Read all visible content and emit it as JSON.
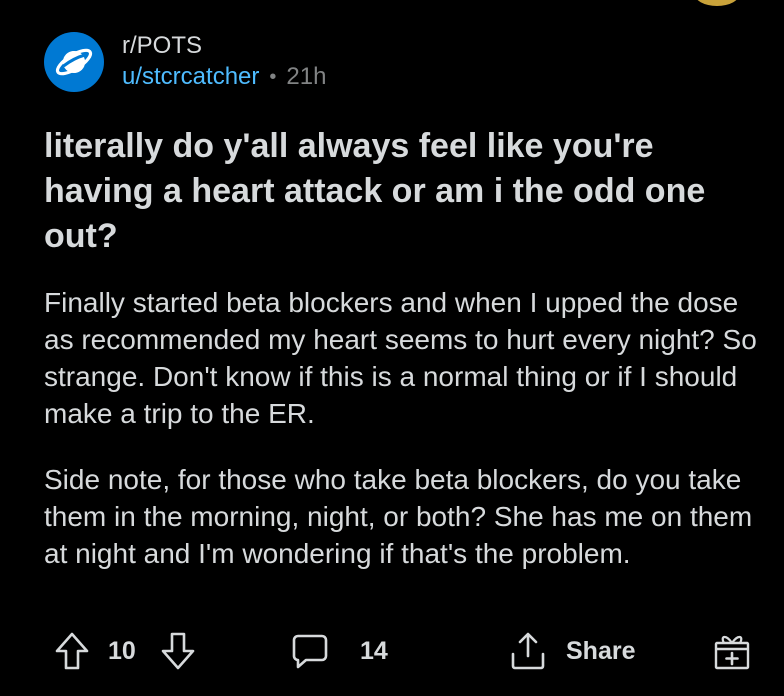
{
  "post": {
    "subreddit": "r/POTS",
    "username": "u/stcrcatcher",
    "separator": "•",
    "time_ago": "21h",
    "title": "literally do y'all always feel like you're having a heart attack or am i the odd one out?",
    "body": [
      "Finally started beta blockers and when I upped the dose as recommended my heart seems to hurt every night? So strange. Don't know if this is a normal thing or if I should make a trip to the ER.",
      "Side note, for those who take beta blockers, do you take them in the morning, night, or both? She has me on them at night and I'm wondering if that's the problem."
    ]
  },
  "actions": {
    "upvote_icon": "upvote-arrow-icon",
    "vote_count": "10",
    "downvote_icon": "downvote-arrow-icon",
    "comment_icon": "comment-bubble-icon",
    "comment_count": "14",
    "share_icon": "share-icon",
    "share_label": "Share",
    "award_icon": "gift-award-icon"
  },
  "colors": {
    "background": "#000000",
    "text": "#d7dadc",
    "username": "#4fbcff",
    "meta": "#818384",
    "avatar": "#0079d3"
  }
}
